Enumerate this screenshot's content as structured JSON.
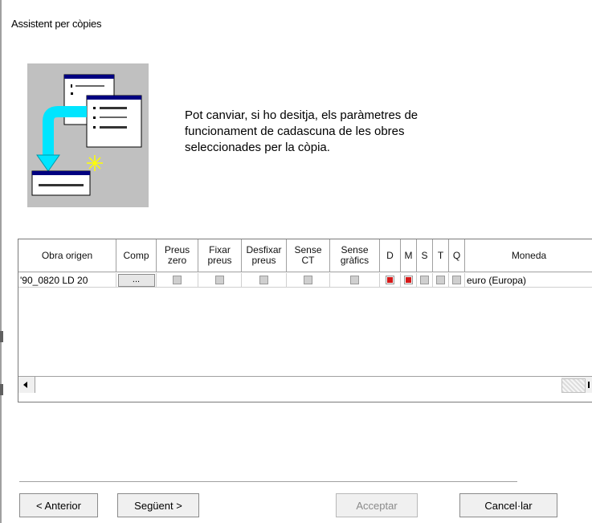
{
  "window": {
    "title": "Assistent per còpies"
  },
  "description": "Pot canviar, si ho desitja, els paràmetres de funcionament de cadascuna de les obres seleccionades per la còpia.",
  "grid": {
    "columns": [
      {
        "label": "Obra origen"
      },
      {
        "label": "Comp"
      },
      {
        "label": "Preus\nzero"
      },
      {
        "label": "Fixar\npreus"
      },
      {
        "label": "Desfixar\npreus"
      },
      {
        "label": "Sense\nCT"
      },
      {
        "label": "Sense\ngràfics"
      },
      {
        "label": "D"
      },
      {
        "label": "M"
      },
      {
        "label": "S"
      },
      {
        "label": "T"
      },
      {
        "label": "Q"
      },
      {
        "label": "Moneda"
      }
    ],
    "rows": [
      {
        "origin": "'90_0820 LD 20",
        "comp_button": "...",
        "preus_zero": false,
        "fixar_preus": false,
        "desfixar_preus": false,
        "sense_ct": false,
        "sense_grafics": false,
        "d": true,
        "m": true,
        "s": false,
        "t": false,
        "q": false,
        "moneda": "euro (Europa)"
      }
    ]
  },
  "buttons": {
    "back": "< Anterior",
    "next": "Següent >",
    "accept": "Acceptar",
    "cancel": "Cancel·lar"
  },
  "colors": {
    "illustration_bg": "#c0c0c0",
    "checked_mark": "#d61a1a",
    "title_bar_blue": "#000080",
    "arrow_cyan": "#00e5ff"
  },
  "icons": [
    "copy-wizard-illustration",
    "scroll-left-icon",
    "scroll-right-icon"
  ]
}
